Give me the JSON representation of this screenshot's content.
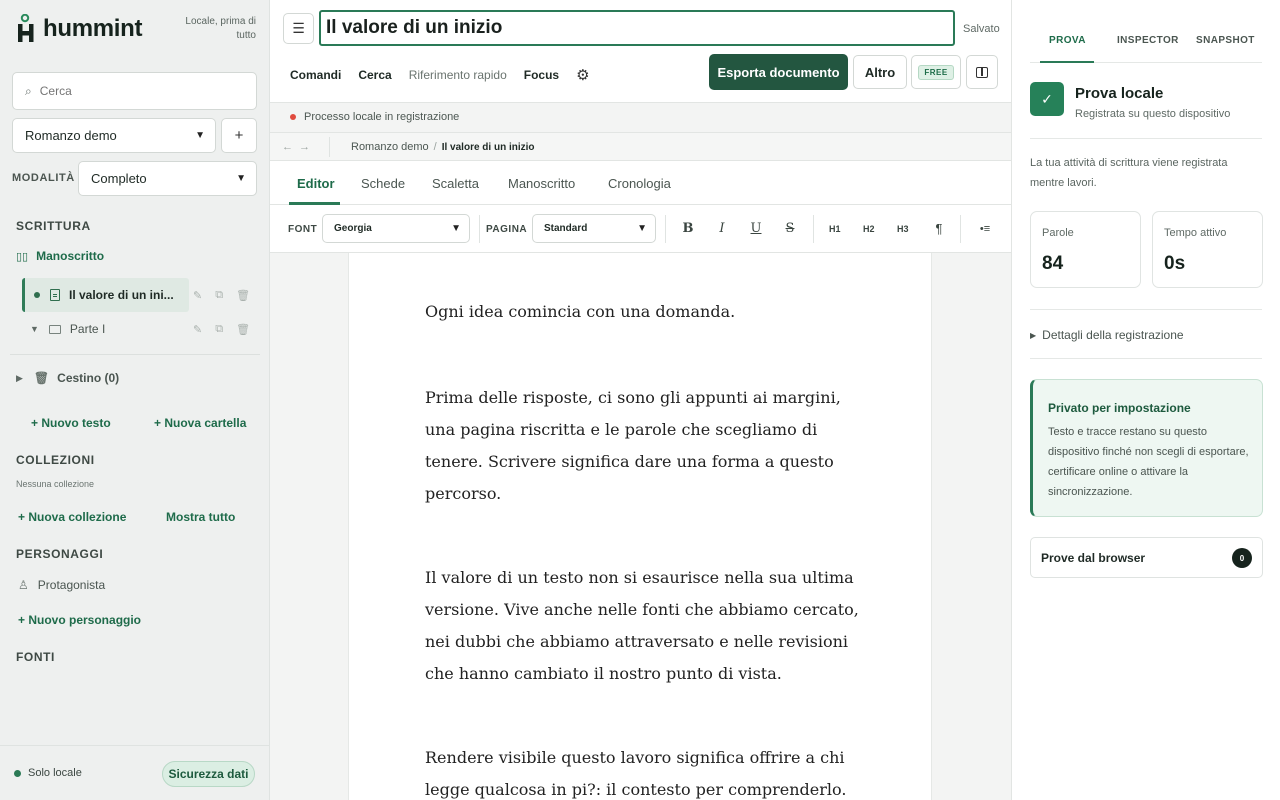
{
  "app": {
    "logo_text": "hummint",
    "logo_subtitle": "Locale, prima di tutto",
    "brand_color": "#235640"
  },
  "sidebar": {
    "search_placeholder": "Cerca",
    "project_select": "Romanzo demo",
    "add_label": "+",
    "mode_label": "MODALITÀ",
    "mode_select": "Completo",
    "writing_title": "SCRITTURA",
    "manuscript_label": "Manoscritto",
    "active_doc": "Il valore di un ini...",
    "part_label": "Parte I",
    "trash_label": "Cestino (0)",
    "new_text": "+ Nuovo testo",
    "new_folder": "+ Nuova cartella",
    "collections_title": "COLLEZIONI",
    "collections_empty": "Nessuna collezione",
    "new_collection": "+ Nuova collezione",
    "show_all": "Mostra tutto",
    "characters_title": "PERSONAGGI",
    "protagonist": "Protagonista",
    "new_character": "+ Nuovo personaggio",
    "sources_title": "FONTI",
    "footer_status": "Solo locale",
    "security_button": "Sicurezza dati"
  },
  "editor": {
    "doc_title": "Il valore di un inizio",
    "saved_status": "Salvato",
    "menu": [
      "Comandi",
      "Cerca",
      "Riferimento rapido",
      "Focus"
    ],
    "export_button": "Esporta documento",
    "more_button": "Altro",
    "free_badge": "FREE",
    "recording_status": "Processo locale in registrazione",
    "breadcrumb_root": "Romanzo demo",
    "breadcrumb_current": "Il valore di un inizio",
    "tabs": [
      "Editor",
      "Schede",
      "Scaletta",
      "Manoscritto",
      "Cronologia"
    ],
    "font_label": "FONT",
    "font_value": "Georgia",
    "page_label": "PAGINA",
    "page_value": "Standard",
    "format_buttons": [
      "B",
      "I",
      "U",
      "S"
    ],
    "heading_buttons": [
      "H1",
      "H2",
      "H3",
      "¶"
    ],
    "list_button": "•≡",
    "paragraphs": [
      "Ogni idea comincia con una domanda.",
      "Prima delle risposte, ci sono gli appunti ai margini, una pagina riscritta e le parole che scegliamo di tenere. Scrivere significa dare una forma a questo percorso.",
      "Il valore di un testo non si esaurisce nella sua ultima versione. Vive anche nelle fonti che abbiamo cercato, nei dubbi che abbiamo attraversato e nelle revisioni che hanno cambiato il nostro punto di vista.",
      "Rendere visibile questo lavoro significa offrire a chi legge qualcosa in pi?: il contesto per comprenderlo."
    ]
  },
  "right_panel": {
    "tabs": [
      "PROVA",
      "INSPECTOR",
      "SNAPSHOT"
    ],
    "title": "Prova locale",
    "subtitle": "Registrata su questo dispositivo",
    "description": "La tua attività di scrittura viene registrata mentre lavori.",
    "words_label": "Parole",
    "words_value": "84",
    "active_time_label": "Tempo attivo",
    "active_time_value": "0s",
    "details_label": "Dettagli della registrazione",
    "privacy_title": "Privato per impostazione",
    "privacy_body": "Testo e tracce restano su questo dispositivo finché non scegli di esportare, certificare online o attivare la sincronizzazione.",
    "browser_proofs_label": "Prove dal browser",
    "browser_proofs_count": "0"
  }
}
